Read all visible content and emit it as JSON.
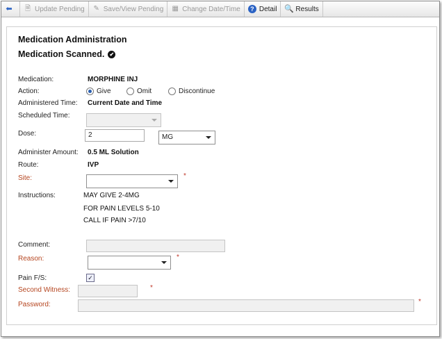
{
  "toolbar": {
    "back_label": "",
    "update_pending": "Update Pending",
    "save_view_pending": "Save/View Pending",
    "change_date_time": "Change Date/Time",
    "detail": "Detail",
    "results": "Results"
  },
  "form": {
    "title": "Medication Administration",
    "subtitle": "Medication Scanned.",
    "medication_label": "Medication:",
    "medication_value": "MORPHINE INJ",
    "action_label": "Action:",
    "action_options": [
      "Give",
      "Omit",
      "Discontinue"
    ],
    "action_selected": "Give",
    "administered_time_label": "Administered Time:",
    "administered_time_value": "Current Date and Time",
    "scheduled_time_label": "Scheduled Time:",
    "scheduled_time_value": "",
    "dose_label": "Dose:",
    "dose_value": "2",
    "dose_unit": "MG",
    "administer_amount_label": "Administer Amount:",
    "administer_amount_value": "0.5 ML Solution",
    "route_label": "Route:",
    "route_value": "IVP",
    "site_label": "Site:",
    "site_value": "",
    "instructions_label": "Instructions:",
    "instructions": [
      "MAY GIVE 2-4MG",
      "FOR PAIN LEVELS 5-10",
      "CALL IF PAIN >7/10"
    ],
    "comment_label": "Comment:",
    "comment_value": "",
    "reason_label": "Reason:",
    "reason_value": "",
    "pain_fs_label": "Pain F/S:",
    "pain_fs_checked": true,
    "second_witness_label": "Second Witness:",
    "second_witness_value": "",
    "password_label": "Password:",
    "password_value": "",
    "required_marker": "*"
  },
  "colors": {
    "required_label": "#b5451f",
    "required_star": "#c0392b",
    "radio_selected": "#2a5fb0"
  }
}
